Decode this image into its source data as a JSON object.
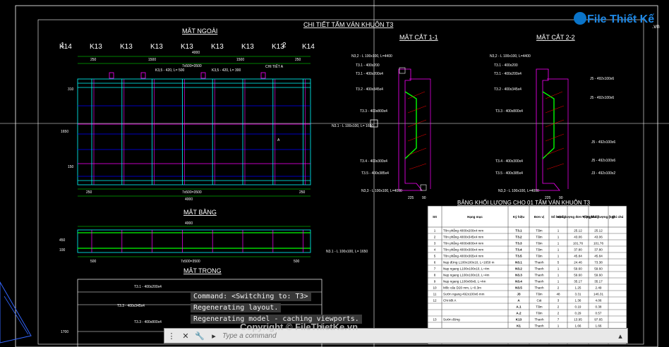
{
  "drawing": {
    "main_title": "CHI TIẾT TẤM VÁN KHUÔN T3",
    "outer_view": {
      "title": "MẶT NGOÀI",
      "k_labels": [
        "K14",
        "K13",
        "K13",
        "K13",
        "K13",
        "K13",
        "K13",
        "K13",
        "K14"
      ],
      "top_dims": [
        "4000",
        "250",
        "1500",
        "1500",
        "250"
      ],
      "subdim": "7x500=3500",
      "callouts": [
        "K3,5 - 420, L= 500",
        "K3,5 - 420, L= 300",
        "CHI TIẾT A"
      ],
      "side_dims": [
        "150",
        "310",
        "1650",
        "1500"
      ],
      "bottom_dims": [
        "250",
        "7x500=3500",
        "250"
      ],
      "bottom_total": "4000",
      "tag": "A",
      "section_marks": [
        "1",
        "1",
        "2",
        "2"
      ]
    },
    "section_1": {
      "title": "MẶT CẮT 1-1",
      "labels": [
        "N3,2 - L 100x100, L=4400",
        "T3.1 - 400x200",
        "T3.1 - 400x200x4",
        "T3.2 - 400x345x4",
        "T3.3 - 400x800x4",
        "N3.1 - L 100x100, L= 1650",
        "T3.4 - 400x300x4",
        "T3.5 - 400x385x4",
        "N3,3 - L 100x100, L=4000"
      ],
      "dims": [
        "225",
        "90"
      ]
    },
    "section_2": {
      "title": "MẶT CẮT 2-2",
      "labels": [
        "N3,2 - L 100x100, L=4400",
        "T3.1 - 400x200",
        "T3.1 - 400x200x4",
        "T3.2 - 400x345x4",
        "T3.3 - 400x800x4",
        "T3.4 - 400x300x4",
        "T3.5 - 400x385x4",
        "N3,3 - L 100x100, L=4000"
      ],
      "right_labels": [
        "J5 - 492x100x6",
        "J5 - 492x100x6",
        "J5 - 492x100x6",
        "J5 - 492x100x6",
        "J3 - 492x100x2"
      ],
      "dims": [
        "225",
        "90"
      ]
    },
    "floor_view": {
      "title": "MẶT BẰNG",
      "top_dim": "4000",
      "side_dims": [
        "450",
        "100"
      ],
      "bottom_dims": [
        "500",
        "7x500=3500",
        "500"
      ],
      "label": "N3.1 - L 100x100, L= 1650"
    },
    "inner_view": {
      "title": "MẶT TRONG",
      "labels": [
        "T3.1 - 400x200x4",
        "T3.3 - 400x345x4",
        "T3.3 - 400x800x4"
      ],
      "side_dim": "1700"
    },
    "table": {
      "title": "BẢNG KHỐI LƯỢNG CHO 01 TẤM VÁN KHUÔN T3",
      "headers": [
        "Stt",
        "Hạng mục",
        "Ký hiệu",
        "Đơn vị",
        "Số lượng",
        "Khối lượng đơn vị (Kg/đ.vị)",
        "Tổng khối lượng (kg)",
        "Ghi chú"
      ],
      "rows": [
        [
          "1",
          "Tôn phẳng 4000x200x4 mm",
          "T3.1",
          "Tấm",
          "1",
          "25.12",
          "25.12",
          ""
        ],
        [
          "2",
          "Tôn phẳng 4000x345x4 mm",
          "T3.2",
          "Tấm",
          "1",
          "43.06",
          "43.06",
          ""
        ],
        [
          "3",
          "Tôn phẳng 4000x800x4 mm",
          "T3.3",
          "Tấm",
          "1",
          "101.76",
          "101.76",
          ""
        ],
        [
          "4",
          "Tôn phẳng 4000x300x4 mm",
          "T3.4",
          "Tấm",
          "1",
          "37.80",
          "37.80",
          ""
        ],
        [
          "5",
          "Tôn phẳng 4000x365x4 mm",
          "T3.5",
          "Tấm",
          "1",
          "45.84",
          "45.84",
          ""
        ],
        [
          "6",
          "Nẹp đứng L100x100x10, L=1650 m",
          "N3.1",
          "Thanh",
          "5",
          "24.46",
          "73.38",
          ""
        ],
        [
          "7",
          "Nẹp ngang L100x100x10, L=4m",
          "N3.2",
          "Thanh",
          "1",
          "59.60",
          "59.60",
          ""
        ],
        [
          "8",
          "Nẹp ngang L100x100x10, L=4m",
          "N3.3",
          "Thanh",
          "1",
          "59.60",
          "59.60",
          ""
        ],
        [
          "9",
          "Nẹp ngang L100x80x8, L=4m",
          "N3.4",
          "Thanh",
          "1",
          "35.17",
          "35.17",
          ""
        ],
        [
          "10",
          "Mốc cẩu D20 mm, L=0.3m",
          "N3.5",
          "Thanh",
          "2",
          "1.25",
          "2.49",
          ""
        ],
        [
          "11",
          "Sườn ngang 492x100x6 mm",
          "J3",
          "Tấm",
          "48",
          "3.31",
          "146.31",
          ""
        ],
        [
          "12",
          "Chi tiết A",
          "A",
          "Cái",
          "3",
          "1.36",
          "4.06",
          ""
        ],
        [
          "",
          "",
          "A.1",
          "Tấm",
          "2",
          "0.19",
          "0.38",
          ""
        ],
        [
          "",
          "",
          "A.2",
          "Tấm",
          "2",
          "0.29",
          "0.57",
          ""
        ],
        [
          "13",
          "Sườn đứng",
          "K13",
          "Thanh",
          "7",
          "13.95",
          "97.65",
          ""
        ],
        [
          "",
          "",
          "K1",
          "Thanh",
          "1",
          "1.66",
          "1.66",
          ""
        ],
        [
          "",
          "",
          "K2.1",
          "Thanh",
          "1",
          "2.61",
          "2.61",
          ""
        ],
        [
          "",
          "",
          "K2.2",
          "Thanh",
          "1",
          "2.61",
          "2.61",
          ""
        ]
      ]
    }
  },
  "command_history": [
    "Command:   <Switching to: T3>",
    "Regenerating layout.",
    "Regenerating model - caching viewports."
  ],
  "command_input": {
    "placeholder": "Type a command"
  },
  "brand": {
    "logo_text": "File Thiết Kế",
    "logo_suffix": ".vn",
    "watermark": "Copyright © FileThietKe.vn"
  },
  "colors": {
    "background": "#000000",
    "cyan": "#00ffff",
    "magenta": "#ff00ff",
    "green": "#00ff00",
    "red": "#ff0000",
    "blue": "#0000ff",
    "yellow": "#ffff00"
  }
}
